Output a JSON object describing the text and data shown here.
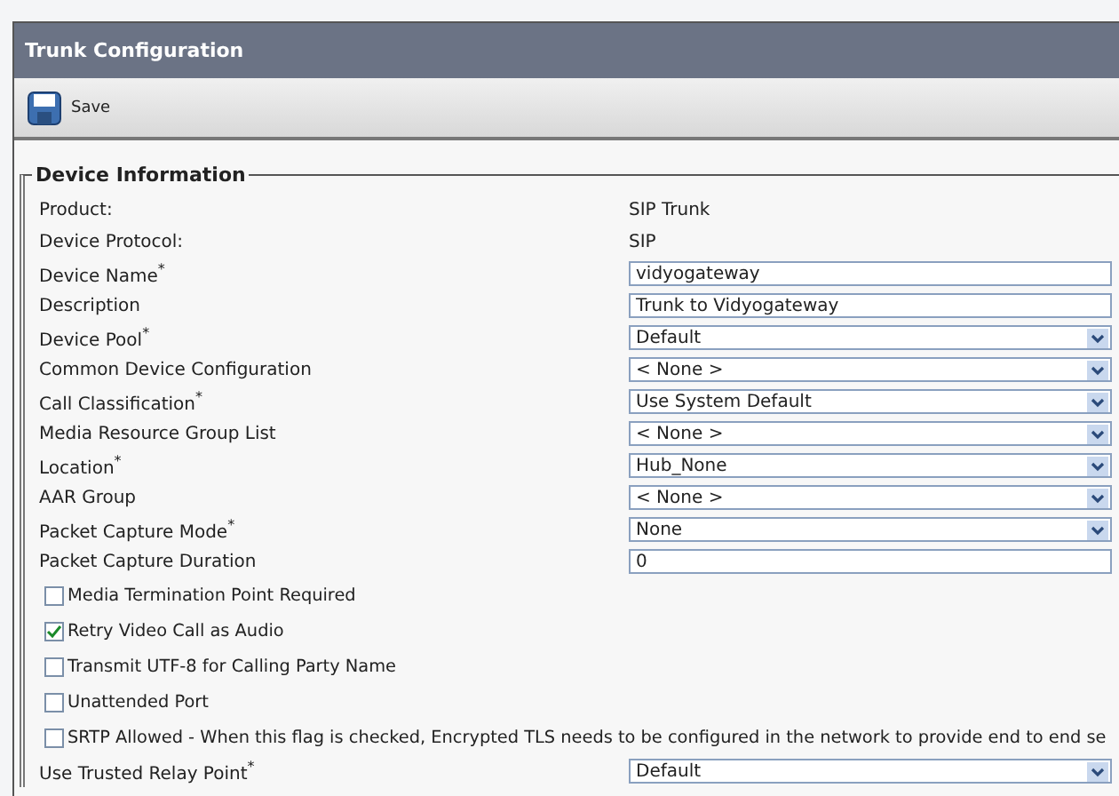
{
  "window": {
    "title": "Trunk Configuration"
  },
  "toolbar": {
    "buttons": [
      {
        "label": "Save"
      }
    ]
  },
  "section": {
    "title": "Device Information",
    "fields": [
      {
        "kind": "static",
        "label": "Product:",
        "value": "SIP Trunk"
      },
      {
        "kind": "static",
        "label": "Device Protocol:",
        "value": "SIP"
      },
      {
        "kind": "text",
        "label": "Device Name$^{*}$",
        "value": "vidyogateway"
      },
      {
        "kind": "text",
        "label": "Description",
        "value": "Trunk to Vidyogateway"
      },
      {
        "kind": "select",
        "label": "Device Pool$^{*}$",
        "value": "Default"
      },
      {
        "kind": "select",
        "label": "Common Device Configuration",
        "value": "< None >"
      },
      {
        "kind": "select",
        "label": "Call Classification$^{*}$",
        "value": "Use System Default"
      },
      {
        "kind": "select",
        "label": "Media Resource Group List",
        "value": "< None >"
      },
      {
        "kind": "select",
        "label": "Location$^{*}$",
        "value": "Hub_None"
      },
      {
        "kind": "select",
        "label": "AAR Group",
        "value": "< None >"
      },
      {
        "kind": "select",
        "label": "Packet Capture Mode$^{*}$",
        "value": "None"
      },
      {
        "kind": "text",
        "label": "Packet Capture Duration",
        "value": "0"
      },
      {
        "kind": "checkbox",
        "label": "Media Termination Point Required",
        "checked": false
      },
      {
        "kind": "checkbox",
        "label": "Retry Video Call as Audio",
        "checked": true
      },
      {
        "kind": "checkbox",
        "label": "Transmit UTF-8 for Calling Party Name",
        "checked": false
      },
      {
        "kind": "checkbox",
        "label": "Unattended Port",
        "checked": false
      },
      {
        "kind": "checkbox",
        "label": "SRTP Allowed - When this flag is checked, Encrypted TLS needs to be configured in the network to provide end to end se",
        "checked": false
      },
      {
        "kind": "select",
        "label": "Use Trusted Relay Point$^{*}$",
        "value": "Default"
      }
    ]
  }
}
